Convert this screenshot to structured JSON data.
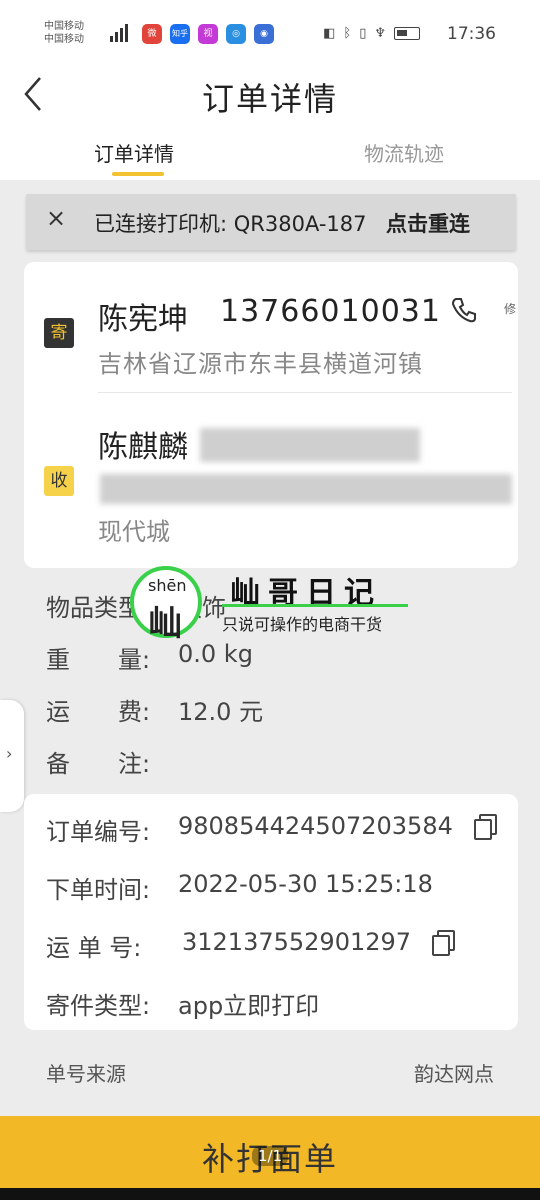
{
  "status_bar": {
    "carrier_1": "中国移动",
    "carrier_2": "中国移动",
    "app_icon_labels": [
      "微",
      "知乎",
      "视",
      "◎",
      "◉"
    ],
    "time": "17:36"
  },
  "header": {
    "title": "订单详情",
    "tabs": [
      {
        "label": "订单详情",
        "active": true
      },
      {
        "label": "物流轨迹",
        "active": false
      }
    ]
  },
  "printer_banner": {
    "close": "×",
    "text": "已连接打印机: QR380A-187",
    "reconnect": "点击重连"
  },
  "sender": {
    "tag": "寄",
    "name": "陈宪坤",
    "phone": "13766010031",
    "edit": "修",
    "address": "吉林省辽源市东丰县横道河镇"
  },
  "receiver": {
    "tag": "收",
    "name": "陈麒麟",
    "address_last": "现代城"
  },
  "watermark": {
    "pinyin": "shēn",
    "char": "屾",
    "title": "屾哥日记",
    "subtitle": "只说可操作的电商干货"
  },
  "item_info": [
    {
      "label": "物品类型:",
      "value": "服饰"
    },
    {
      "label": "重　　量:",
      "value": "0.0 kg"
    },
    {
      "label": "运　　费:",
      "value": "12.0 元"
    },
    {
      "label": "备　　注:",
      "value": ""
    }
  ],
  "order_info": [
    {
      "label": "订单编号:",
      "value": "9808544245072035​84",
      "copy": true
    },
    {
      "label": "下单时间:",
      "value": "2022-05-30 15:25:18",
      "copy": false
    },
    {
      "label": "运 单 号:",
      "value": "312137552901297",
      "copy": true
    },
    {
      "label": "寄件类型:",
      "value": "app立即打印",
      "copy": false
    }
  ],
  "source": {
    "label": "单号来源",
    "value": "韵达网点"
  },
  "bottom_button": {
    "label": "补打面单"
  },
  "pager": "1/1",
  "colors": {
    "accent": "#f2b825",
    "tab_indicator": "#f2c230",
    "watermark_green": "#3ad14a"
  }
}
